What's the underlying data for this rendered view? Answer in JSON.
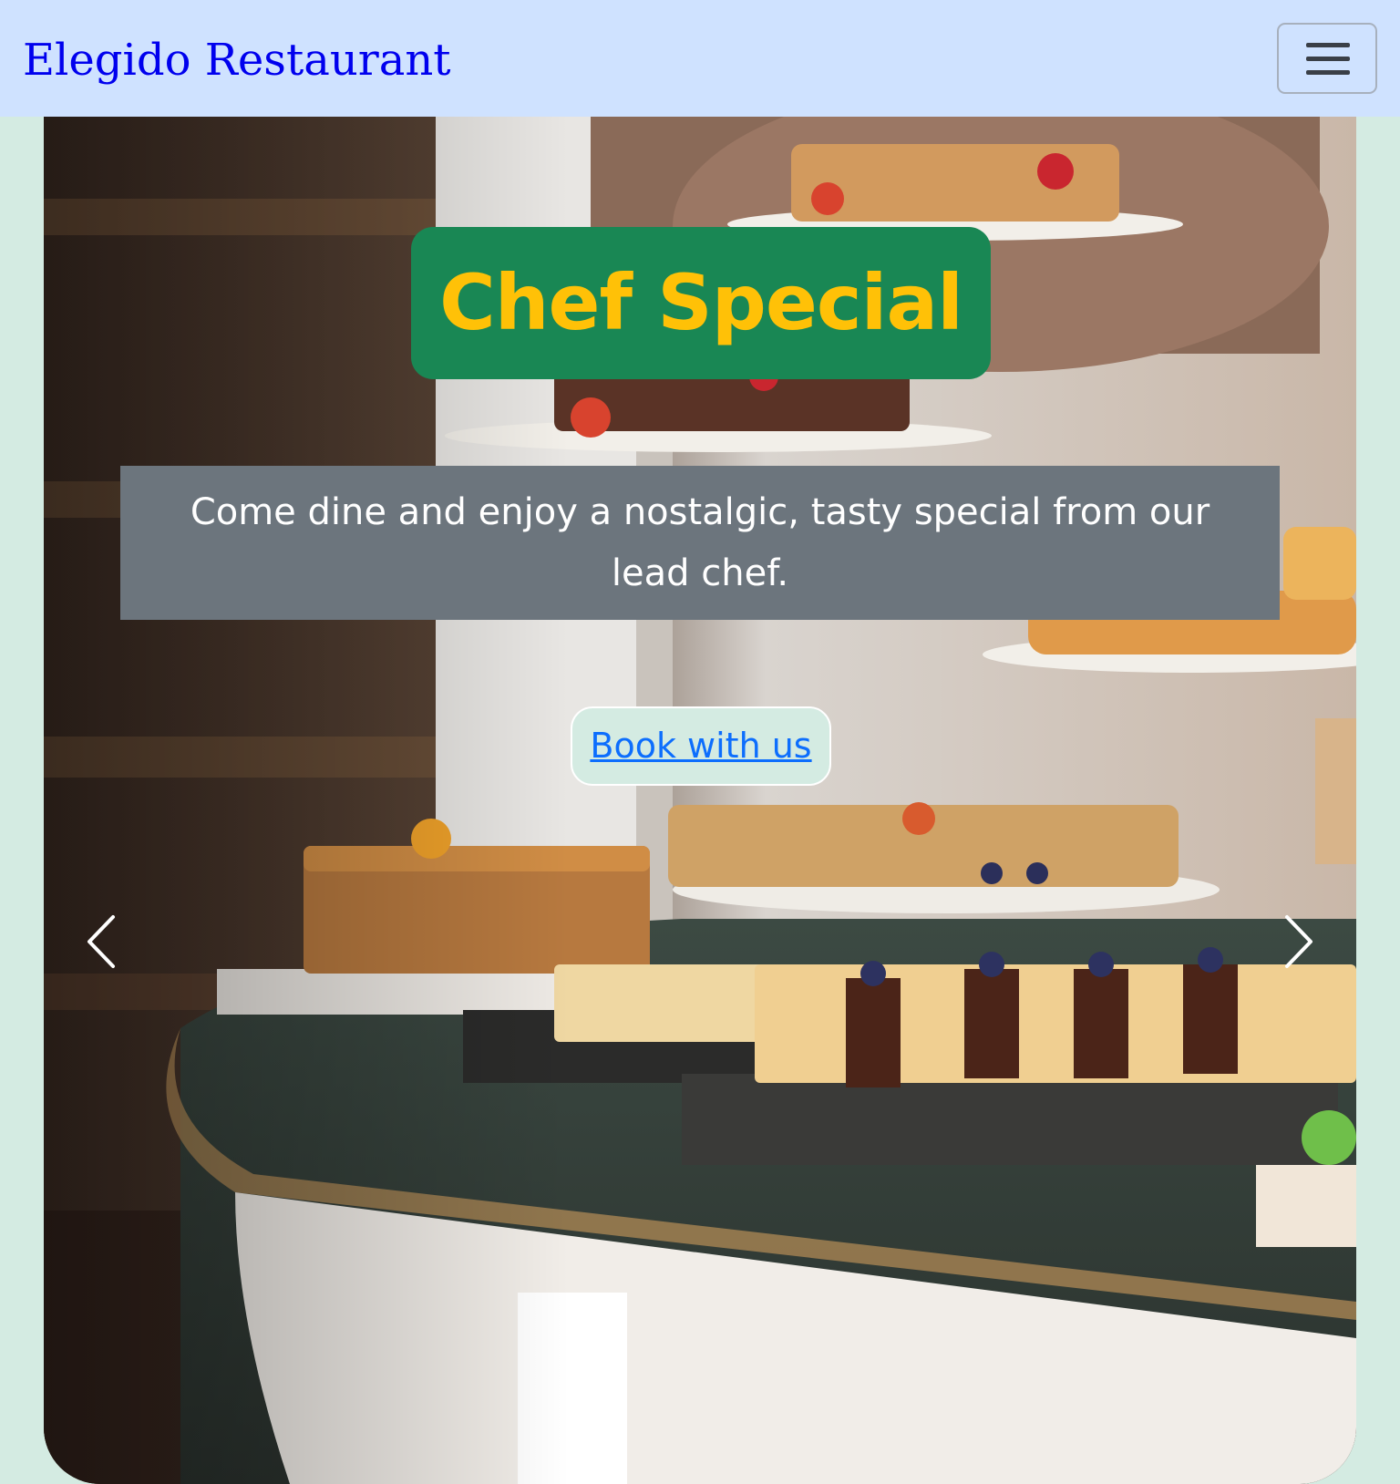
{
  "navbar": {
    "brand": "Elegido Restaurant",
    "toggler_icon": "hamburger-icon"
  },
  "hero": {
    "title": "Chef Special",
    "description": "Come dine and enjoy a nostalgic, tasty special from our lead chef.",
    "cta_label": "Book with us",
    "prev_icon": "chevron-left-icon",
    "next_icon": "chevron-right-icon",
    "image_subject": "dessert buffet counter with cakes and pastries"
  },
  "colors": {
    "navbar_bg": "#cfe2ff",
    "brand_text": "#0000ee",
    "page_bg": "#d4ebe2",
    "title_bg": "#198754",
    "title_text": "#ffc107",
    "caption_bg": "#6c757d",
    "link": "#0d6efd"
  }
}
